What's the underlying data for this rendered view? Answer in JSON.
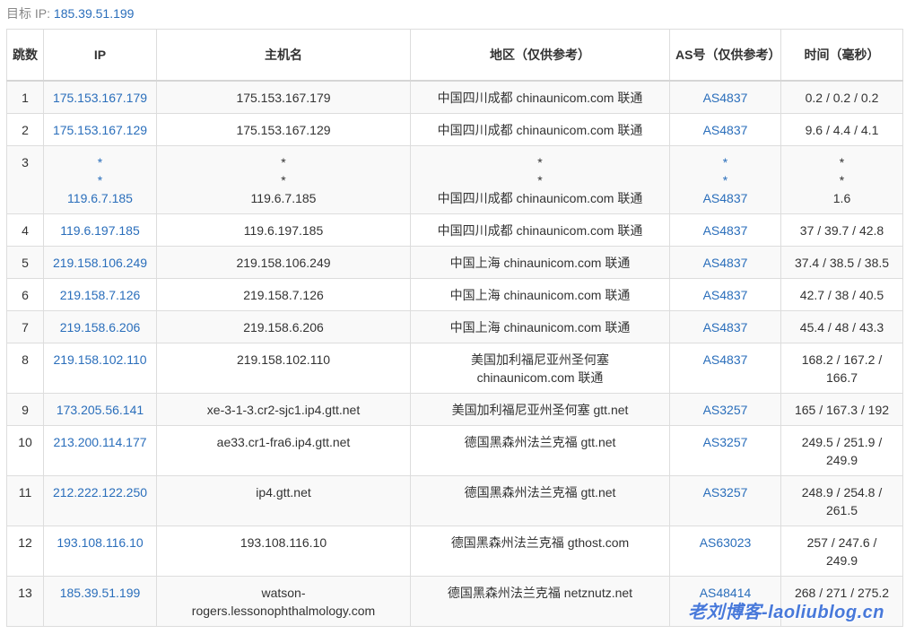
{
  "target": {
    "label": "目标 IP:",
    "ip": "185.39.51.199"
  },
  "headers": {
    "hop": "跳数",
    "ip": "IP",
    "host": "主机名",
    "region": "地区（仅供参考）",
    "as": "AS号（仅供参考）",
    "time": "时间（毫秒）"
  },
  "rows": [
    {
      "hop": "1",
      "ip": [
        "175.153.167.179"
      ],
      "host": [
        "175.153.167.179"
      ],
      "region": [
        "中国四川成都 chinaunicom.com 联通"
      ],
      "as": [
        "AS4837"
      ],
      "time": [
        "0.2 / 0.2 / 0.2"
      ]
    },
    {
      "hop": "2",
      "ip": [
        "175.153.167.129"
      ],
      "host": [
        "175.153.167.129"
      ],
      "region": [
        "中国四川成都 chinaunicom.com 联通"
      ],
      "as": [
        "AS4837"
      ],
      "time": [
        "9.6 / 4.4 / 4.1"
      ]
    },
    {
      "hop": "3",
      "ip": [
        "*",
        "*",
        "119.6.7.185"
      ],
      "host": [
        "*",
        "*",
        "119.6.7.185"
      ],
      "region": [
        "*",
        "*",
        "中国四川成都 chinaunicom.com 联通"
      ],
      "as": [
        "*",
        "*",
        "AS4837"
      ],
      "time": [
        "*",
        "*",
        "1.6"
      ]
    },
    {
      "hop": "4",
      "ip": [
        "119.6.197.185"
      ],
      "host": [
        "119.6.197.185"
      ],
      "region": [
        "中国四川成都 chinaunicom.com 联通"
      ],
      "as": [
        "AS4837"
      ],
      "time": [
        "37 / 39.7 / 42.8"
      ]
    },
    {
      "hop": "5",
      "ip": [
        "219.158.106.249"
      ],
      "host": [
        "219.158.106.249"
      ],
      "region": [
        "中国上海 chinaunicom.com 联通"
      ],
      "as": [
        "AS4837"
      ],
      "time": [
        "37.4 / 38.5 / 38.5"
      ]
    },
    {
      "hop": "6",
      "ip": [
        "219.158.7.126"
      ],
      "host": [
        "219.158.7.126"
      ],
      "region": [
        "中国上海 chinaunicom.com 联通"
      ],
      "as": [
        "AS4837"
      ],
      "time": [
        "42.7 / 38 / 40.5"
      ]
    },
    {
      "hop": "7",
      "ip": [
        "219.158.6.206"
      ],
      "host": [
        "219.158.6.206"
      ],
      "region": [
        "中国上海 chinaunicom.com 联通"
      ],
      "as": [
        "AS4837"
      ],
      "time": [
        "45.4 / 48 / 43.3"
      ]
    },
    {
      "hop": "8",
      "ip": [
        "219.158.102.110"
      ],
      "host": [
        "219.158.102.110"
      ],
      "region": [
        "美国加利福尼亚州圣何塞",
        "chinaunicom.com 联通"
      ],
      "as": [
        "AS4837"
      ],
      "time": [
        "168.2 / 167.2 /",
        "166.7"
      ]
    },
    {
      "hop": "9",
      "ip": [
        "173.205.56.141"
      ],
      "host": [
        "xe-3-1-3.cr2-sjc1.ip4.gtt.net"
      ],
      "region": [
        "美国加利福尼亚州圣何塞 gtt.net"
      ],
      "as": [
        "AS3257"
      ],
      "time": [
        "165 / 167.3 / 192"
      ]
    },
    {
      "hop": "10",
      "ip": [
        "213.200.114.177"
      ],
      "host": [
        "ae33.cr1-fra6.ip4.gtt.net"
      ],
      "region": [
        "德国黑森州法兰克福 gtt.net"
      ],
      "as": [
        "AS3257"
      ],
      "time": [
        "249.5 / 251.9 /",
        "249.9"
      ]
    },
    {
      "hop": "11",
      "ip": [
        "212.222.122.250"
      ],
      "host": [
        "ip4.gtt.net"
      ],
      "region": [
        "德国黑森州法兰克福 gtt.net"
      ],
      "as": [
        "AS3257"
      ],
      "time": [
        "248.9 / 254.8 /",
        "261.5"
      ]
    },
    {
      "hop": "12",
      "ip": [
        "193.108.116.10"
      ],
      "host": [
        "193.108.116.10"
      ],
      "region": [
        "德国黑森州法兰克福 gthost.com"
      ],
      "as": [
        "AS63023"
      ],
      "time": [
        "257 / 247.6 /",
        "249.9"
      ]
    },
    {
      "hop": "13",
      "ip": [
        "185.39.51.199"
      ],
      "host": [
        "watson-",
        "rogers.lessonophthalmology.com"
      ],
      "region": [
        "德国黑森州法兰克福 netznutz.net"
      ],
      "as": [
        "AS48414"
      ],
      "time": [
        "268 / 271 / 275.2"
      ]
    }
  ],
  "watermark": "老刘博客-laoliublog.cn"
}
